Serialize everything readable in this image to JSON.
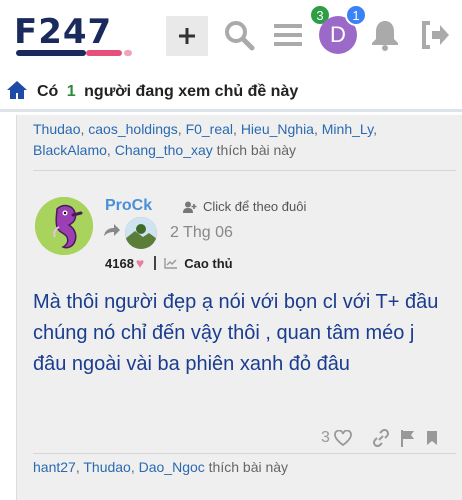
{
  "header": {
    "logo_text": "F247",
    "notification_badge": "3",
    "avatar_letter": "D",
    "avatar_badge": "1"
  },
  "topic_bar": {
    "prefix": "Có",
    "count": "1",
    "suffix": "người đang xem chủ đề này"
  },
  "prev_post": {
    "liked_by": [
      "Thudao",
      "caos_holdings",
      "F0_real",
      "Hieu_Nghia",
      "Minh_Ly",
      "BlackAlamo",
      "Chang_tho_xay"
    ],
    "liked_suffix": "thích bài này"
  },
  "post": {
    "username": "ProCk",
    "follow_label": "Click để theo đuôi",
    "date": "2 Thg 06",
    "reputation": "4168",
    "rank": "Cao thủ",
    "body": "Mà thôi người đẹp ạ nói với bọn cl với T+ đầu chúng nó chỉ đến vậy thôi , quan tâm méo j đâu ngoài vài ba phiên xanh đỏ đâu",
    "like_count": "3",
    "liked_by": [
      "hant27",
      "Thudao",
      "Dao_Ngoc"
    ],
    "liked_suffix": "thích bài này"
  },
  "colors": {
    "brand_navy": "#1a2a5c",
    "link_blue": "#2a6ab0",
    "username_blue": "#4a90d9",
    "body_text": "#1a3d8f",
    "badge_green": "#2e9e45",
    "badge_blue": "#3b82f6",
    "avatar_purple": "#9b6ac9"
  }
}
